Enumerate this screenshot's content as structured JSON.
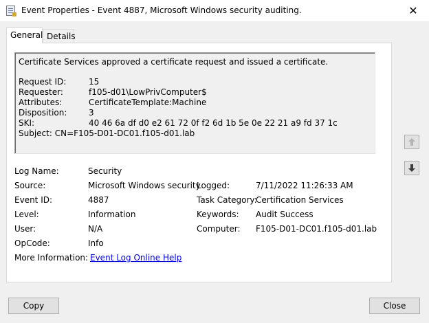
{
  "window": {
    "title": "Event Properties - Event 4887, Microsoft Windows security auditing.",
    "close_glyph": "✕"
  },
  "tabs": [
    {
      "label": "General",
      "active": true
    },
    {
      "label": "Details",
      "active": false
    }
  ],
  "description": {
    "summary": "Certificate Services approved a certificate request and issued a certificate.",
    "fields": [
      {
        "label": "Request ID:",
        "value": "15"
      },
      {
        "label": "Requester:",
        "value": "f105-d01\\LowPrivComputer$"
      },
      {
        "label": "Attributes:",
        "value": "CertificateTemplate:Machine"
      },
      {
        "label": "Disposition:",
        "value": "3"
      },
      {
        "label": "SKI:",
        "value": "40 46 6a df d0 e2 61 72 0f f2 6d 1b 5e 0e 22 21 a9 fd 37 1c"
      }
    ],
    "subject_line": "Subject:  CN=F105-D01-DC01.f105-d01.lab"
  },
  "details": {
    "log_name_label": "Log Name:",
    "log_name": "Security",
    "source_label": "Source:",
    "source": "Microsoft Windows security",
    "logged_label": "Logged:",
    "logged": "7/11/2022 11:26:33 AM",
    "event_id_label": "Event ID:",
    "event_id": "4887",
    "task_category_label": "Task Category:",
    "task_category": "Certification Services",
    "level_label": "Level:",
    "level": "Information",
    "keywords_label": "Keywords:",
    "keywords": "Audit Success",
    "user_label": "User:",
    "user": "N/A",
    "computer_label": "Computer:",
    "computer": "F105-D01-DC01.f105-d01.lab",
    "opcode_label": "OpCode:",
    "opcode": "Info",
    "more_info_label": "More Information:",
    "more_info_link": "Event Log Online Help"
  },
  "buttons": {
    "copy": "Copy",
    "close": "Close"
  },
  "icons": {
    "window": "event-viewer-icon",
    "up": "arrow-up-icon",
    "down": "arrow-down-icon"
  }
}
